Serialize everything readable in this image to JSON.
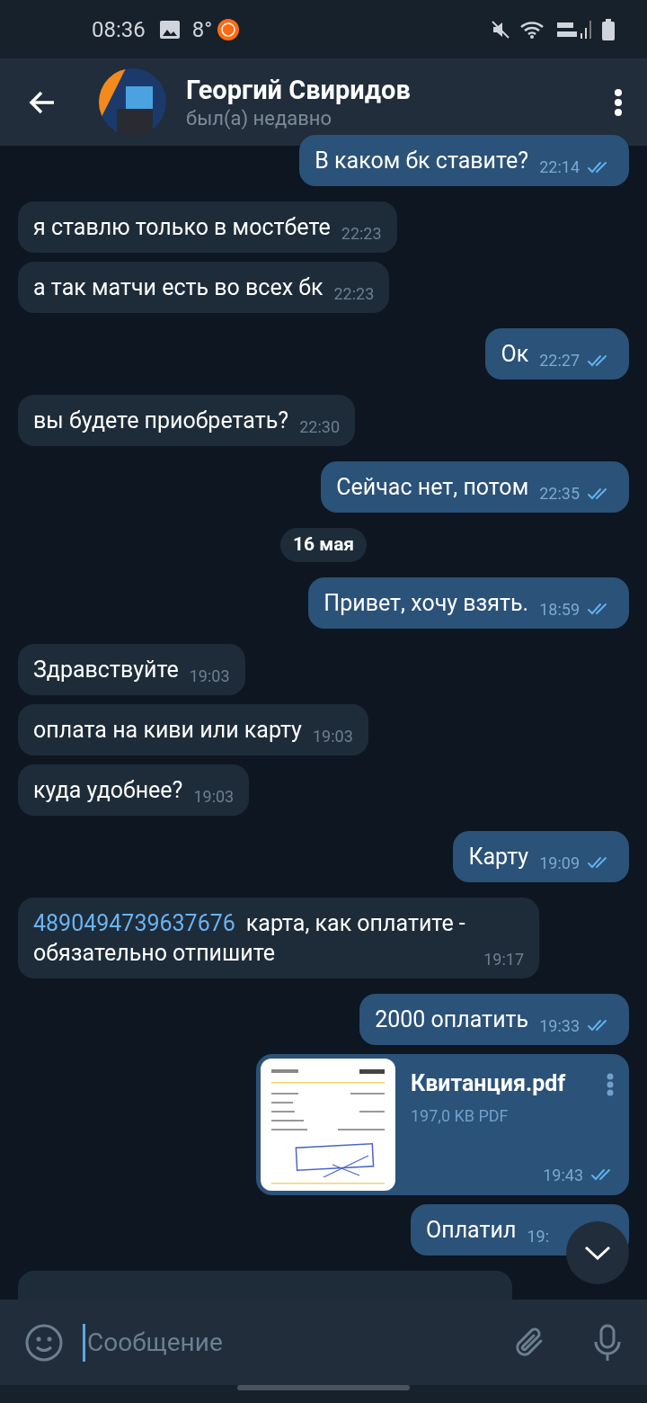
{
  "status_bar": {
    "time": "08:36",
    "temperature": "8°"
  },
  "header": {
    "name": "Георгий Свиридов",
    "status": "был(а) недавно"
  },
  "messages": [
    {
      "kind": "text",
      "out": true,
      "text": "В каком бк ставите?",
      "time": "22:14",
      "read": true
    },
    {
      "kind": "text",
      "out": false,
      "text": "я ставлю только в мостбете",
      "time": "22:23"
    },
    {
      "kind": "text",
      "out": false,
      "text": "а так матчи есть во всех бк",
      "time": "22:23"
    },
    {
      "kind": "text",
      "out": true,
      "text": "Ок",
      "time": "22:27",
      "read": true
    },
    {
      "kind": "text",
      "out": false,
      "text": "вы будете приобретать?",
      "time": "22:30"
    },
    {
      "kind": "text",
      "out": true,
      "text": "Сейчас нет, потом",
      "time": "22:35",
      "read": true
    },
    {
      "kind": "date",
      "text": "16 мая"
    },
    {
      "kind": "text",
      "out": true,
      "text": "Привет, хочу взять.",
      "time": "18:59",
      "read": true
    },
    {
      "kind": "text",
      "out": false,
      "text": "Здравствуйте",
      "time": "19:03"
    },
    {
      "kind": "text",
      "out": false,
      "text": "оплата на киви или карту",
      "time": "19:03"
    },
    {
      "kind": "text",
      "out": false,
      "text": "куда удобнее?",
      "time": "19:03"
    },
    {
      "kind": "text",
      "out": true,
      "text": "Карту",
      "time": "19:09",
      "read": true
    },
    {
      "kind": "text",
      "out": false,
      "link": "4890494739637676",
      "text": "карта, как оплатите - обязательно отпишите",
      "time": "19:17"
    },
    {
      "kind": "text",
      "out": true,
      "text": "2000 оплатить",
      "time": "19:33",
      "read": true
    },
    {
      "kind": "file",
      "out": true,
      "file_name": "Квитанция.pdf",
      "file_size": "197,0 KB PDF",
      "time": "19:43",
      "read": true
    },
    {
      "kind": "text",
      "out": true,
      "text": "Оплатил",
      "time": "19:"
    },
    {
      "kind": "partial",
      "out": false
    }
  ],
  "composer": {
    "placeholder": "Сообщение"
  }
}
